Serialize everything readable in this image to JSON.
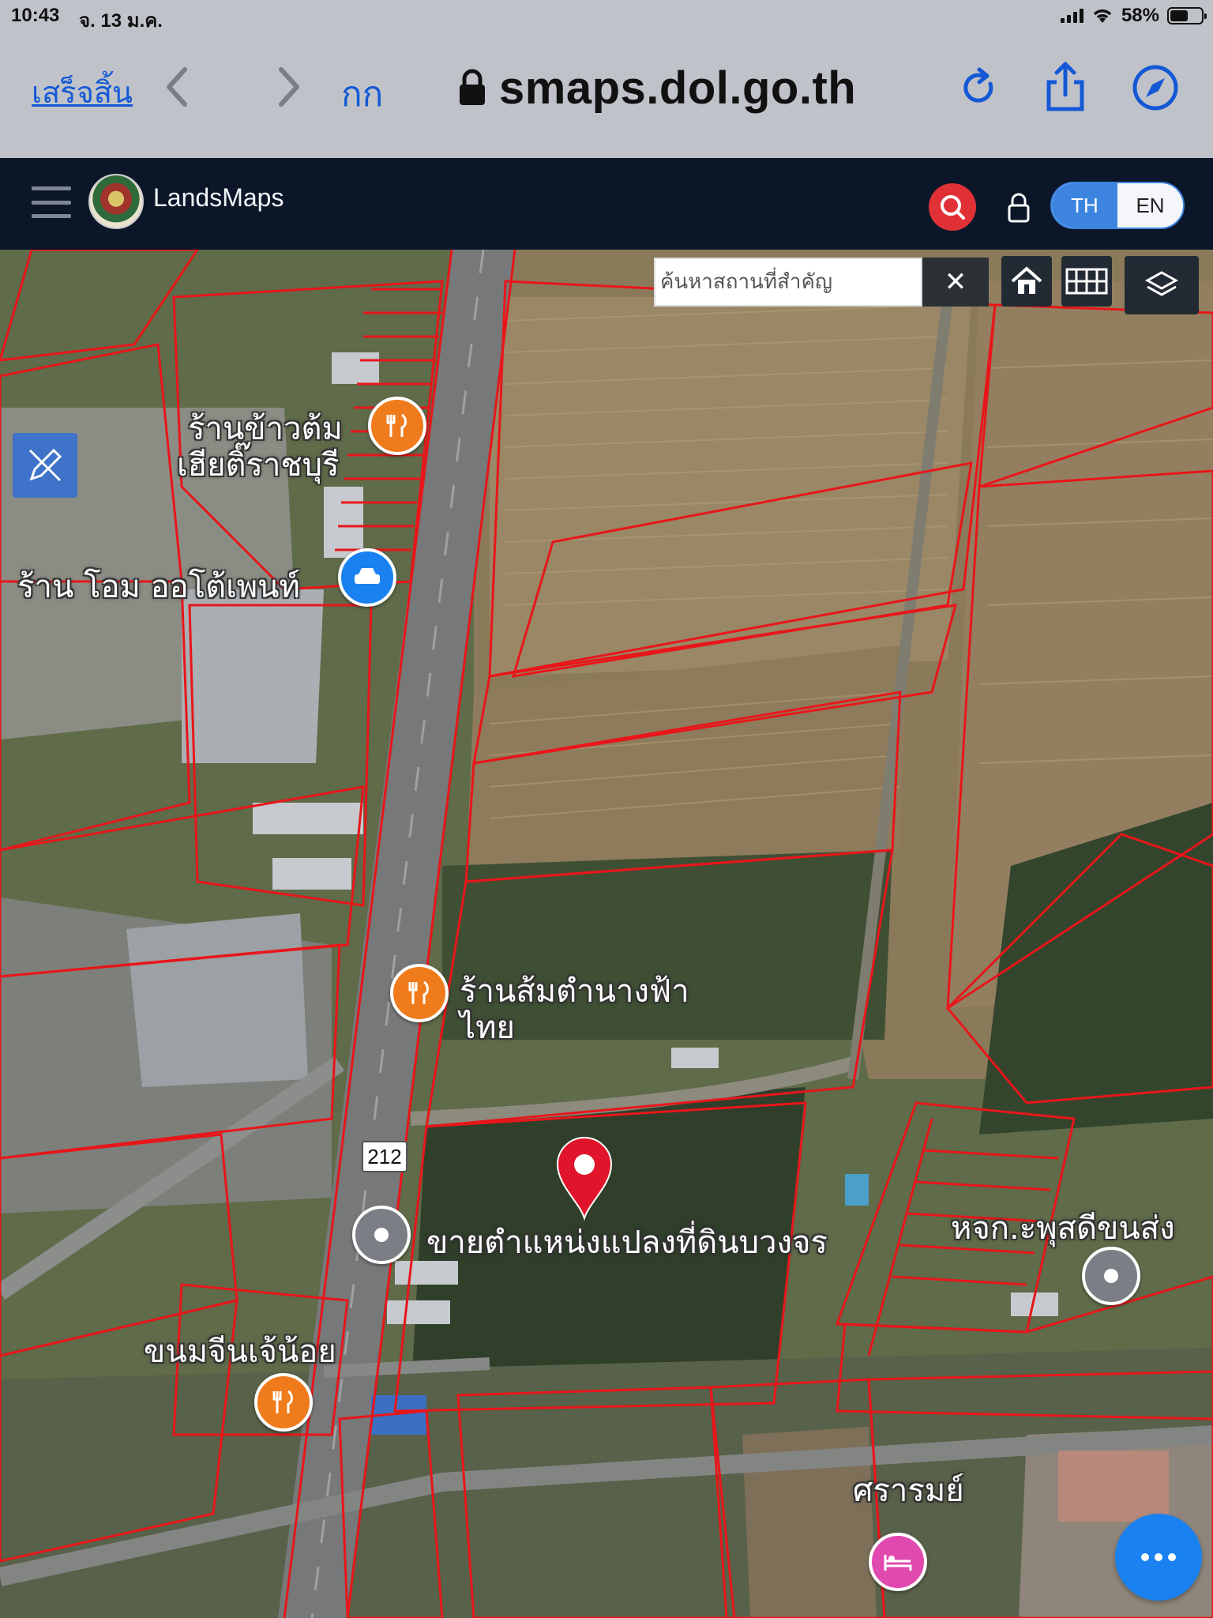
{
  "status": {
    "time": "10:43",
    "date": "จ. 13 ม.ค.",
    "battery": "58%",
    "battery_level": 0.58
  },
  "safari": {
    "done_label": "เสร็จสิ้น",
    "text_size_label": "กก",
    "url": "smaps.dol.go.th"
  },
  "header": {
    "brand": "LandsMaps",
    "lang_th": "TH",
    "lang_en": "EN",
    "active_lang": "TH"
  },
  "map": {
    "search": {
      "placeholder": "ค้นหาสถานที่สำคัญ",
      "clear_label": "✕"
    },
    "road_shield": "212",
    "labels": {
      "shop1": "ร้านข้าวต้ม",
      "shop1b": "เฮียติ๊ราชบุรี",
      "auto_paint": "ร้าน โอม ออโต้เพนท์",
      "somtam": "ร้านส้มตำนางฟ้า",
      "somtam2": "ไทย",
      "sale_land": "ขายตำแหน่งแปลงที่ดินบวงจร",
      "partnership": "หจก.ะพุสดีขนส่ง",
      "khanomjeen": "ขนมจีนเจ้น้อย",
      "resort": "ศรารมย์"
    },
    "colors": {
      "parcel": "#e8161a",
      "accent": "#3d84e0",
      "header_bg": "#0b1729"
    }
  }
}
